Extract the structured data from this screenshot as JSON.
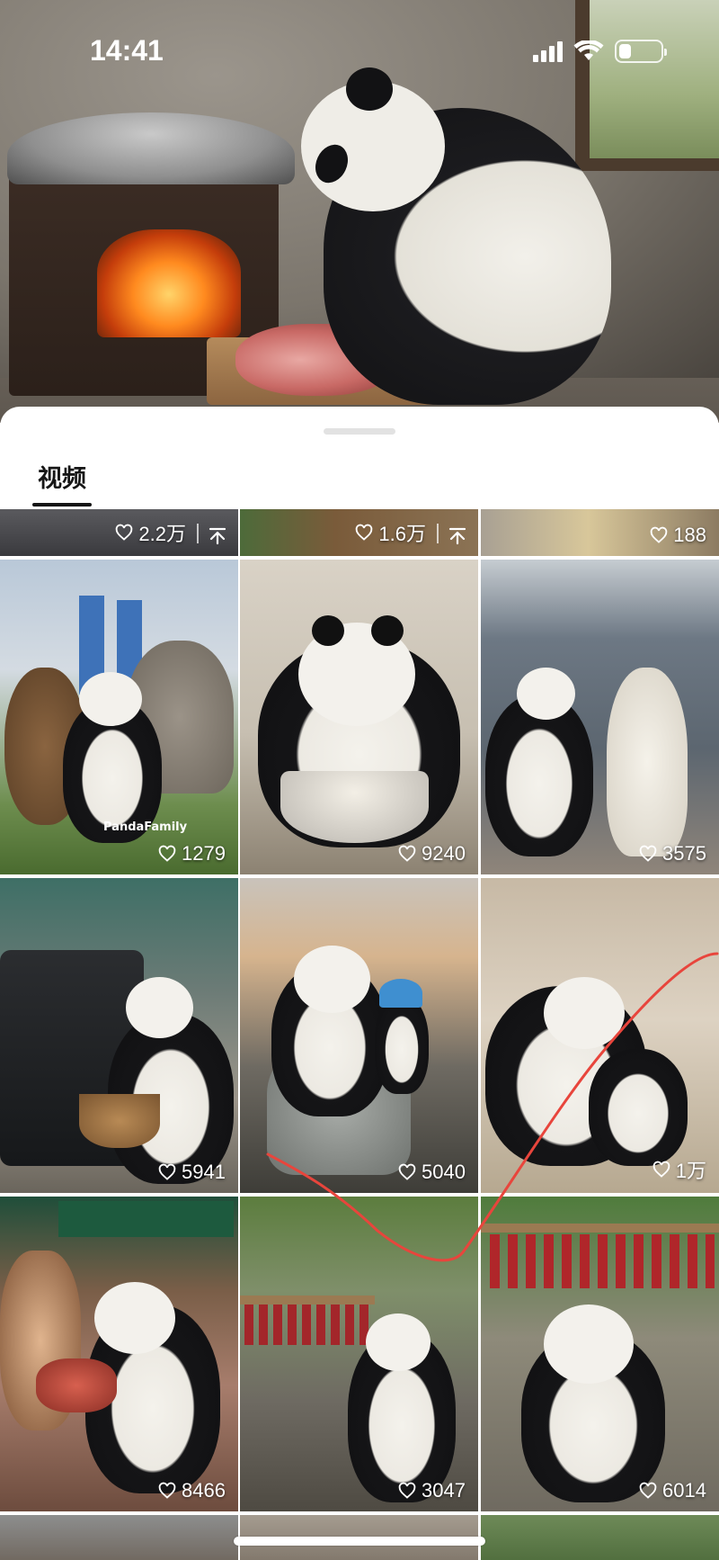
{
  "status_bar": {
    "time": "14:41",
    "battery_level": 0.3
  },
  "hero": {
    "icon": "video-cover-image"
  },
  "tabs": [
    {
      "label": "视频",
      "selected": true
    }
  ],
  "videos": [
    {
      "likes": "2.2万",
      "pinned": true
    },
    {
      "likes": "1.6万",
      "pinned": true
    },
    {
      "likes": "188",
      "pinned": false
    },
    {
      "likes": "1279",
      "watermark": "PandaFamily"
    },
    {
      "likes": "9240"
    },
    {
      "likes": "3575"
    },
    {
      "likes": "5941"
    },
    {
      "likes": "5040"
    },
    {
      "likes": "1万"
    },
    {
      "likes": "8466"
    },
    {
      "likes": "3047"
    },
    {
      "likes": "6014"
    }
  ],
  "colors": {
    "accent_underline": "#161616",
    "annotation_line": "#e8453c"
  }
}
